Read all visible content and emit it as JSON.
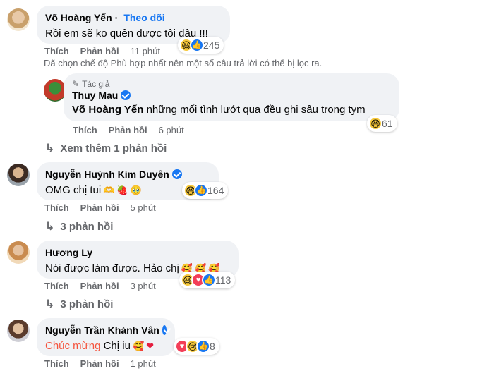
{
  "comments": [
    {
      "name": "Võ Hoàng Yến",
      "follow": "Theo dõi",
      "text": "Rồi em sẽ ko quên được tôi đâu !!!",
      "like": "Thích",
      "reply": "Phản hồi",
      "time": "11 phút",
      "reactions": [
        "haha",
        "like"
      ],
      "count": "245"
    },
    {
      "author_tag": "Tác giả",
      "name": "Thuy Mau",
      "verified": true,
      "tag": "Võ Hoàng Yến",
      "text": "những mối tình lướt qua đều ghi sâu trong tym",
      "like": "Thích",
      "reply": "Phản hồi",
      "time": "6 phút",
      "reactions": [
        "haha"
      ],
      "count": "61"
    },
    {
      "name": "Nguyễn Huỳnh Kim Duyên",
      "verified": true,
      "text": "OMG chị tui",
      "like": "Thích",
      "reply": "Phản hồi",
      "time": "5 phút",
      "reactions": [
        "haha",
        "like"
      ],
      "count": "164"
    },
    {
      "name": "Hương Ly",
      "text": "Nói được làm được. Hảo chị",
      "like": "Thích",
      "reply": "Phản hồi",
      "time": "3 phút",
      "reactions": [
        "haha",
        "love",
        "like"
      ],
      "count": "113"
    },
    {
      "name": "Nguyễn Trần Khánh Vân",
      "verified": true,
      "highlight": "Chúc mừng",
      "text": "Chị iu",
      "like": "Thích",
      "reply": "Phản hồi",
      "time": "1 phút",
      "reactions": [
        "love",
        "sad",
        "like"
      ],
      "count": "8"
    }
  ],
  "filter_note": "Đã chọn chế độ Phù hợp nhất nên một số câu trả lời có thể bị lọc ra.",
  "view_more_1": "Xem thêm 1 phản hồi",
  "replies_2": "3 phản hồi",
  "replies_3": "3 phản hồi",
  "colors": {
    "bubble": "#f0f2f5",
    "link": "#1877f2",
    "muted": "#65676b",
    "highlight": "#f5533d"
  }
}
